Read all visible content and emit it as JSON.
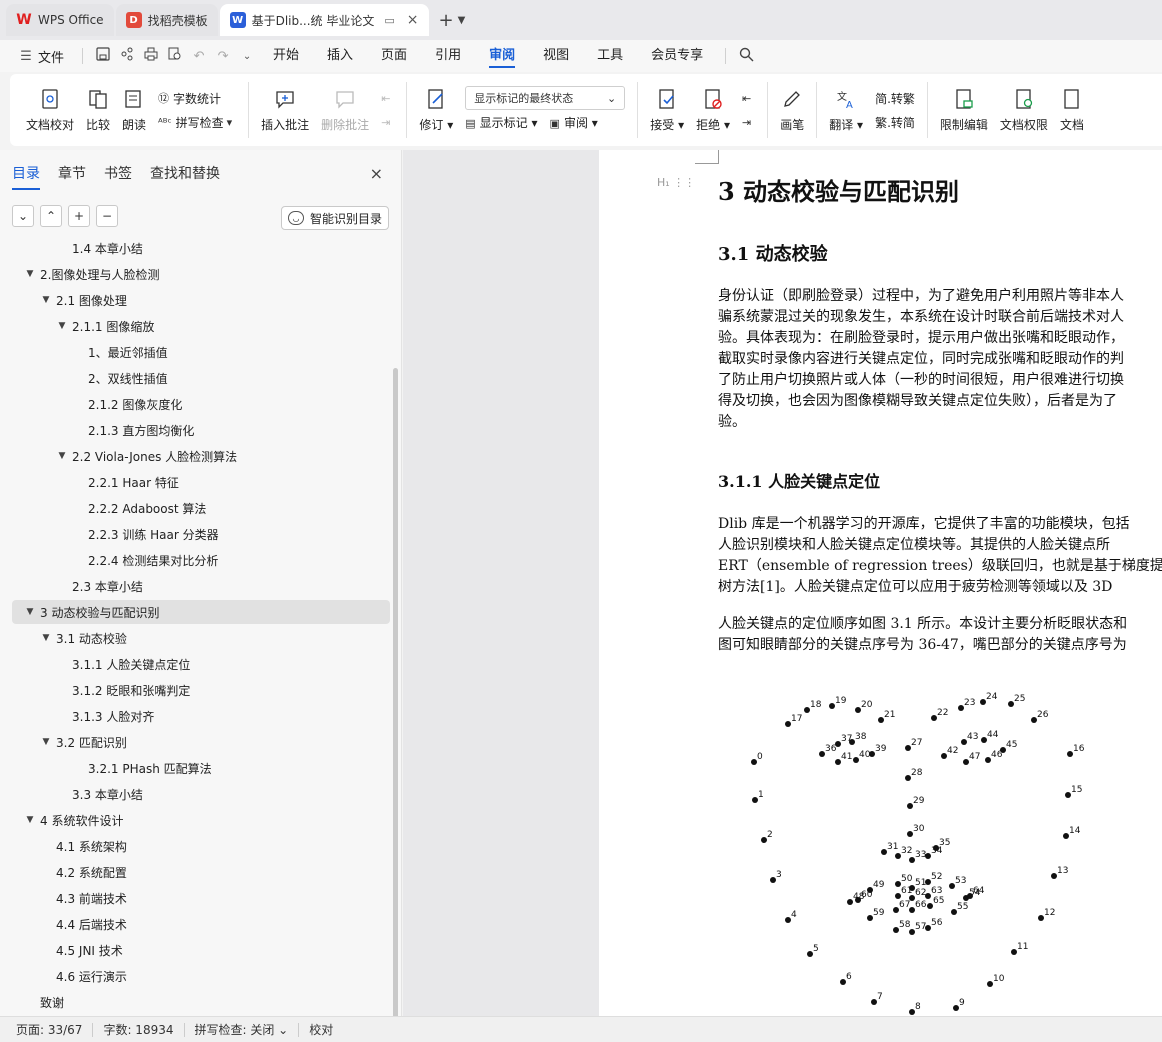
{
  "titlebar": {
    "tabs": [
      {
        "label": "WPS Office",
        "icon": "wps-logo-icon",
        "color": "#e02020"
      },
      {
        "label": "找稻壳模板",
        "icon": "docer-icon",
        "color": "#e24a3b"
      },
      {
        "label": "基于Dlib...统 毕业论文",
        "icon": "word-doc-icon",
        "color": "#2b5fd9"
      }
    ],
    "new_tab": "+",
    "close": "×"
  },
  "menubar": {
    "file_label": "文件",
    "tabs": [
      "开始",
      "插入",
      "页面",
      "引用",
      "审阅",
      "视图",
      "工具",
      "会员专享"
    ],
    "active_tab": "审阅"
  },
  "ribbon": {
    "proofread": "文档校对",
    "compare": "比较",
    "read_aloud": "朗读",
    "word_count": "字数统计",
    "spell_check": "拼写检查",
    "insert_comment": "插入批注",
    "delete_comment": "删除批注",
    "track_changes": "修订",
    "display_state": "显示标记的最终状态",
    "show_markup": "显示标记",
    "review": "审阅",
    "accept": "接受",
    "reject": "拒绝",
    "pen": "画笔",
    "translate": "翻译",
    "trad_to_simp": "简.转繁",
    "simp_to_trad": "繁.转简",
    "restrict_edit": "限制编辑",
    "doc_permission": "文档权限",
    "doc_more": "文档"
  },
  "leftpanel": {
    "tabs": [
      "目录",
      "章节",
      "书签",
      "查找和替换"
    ],
    "close": "×",
    "smart_toc": "智能识别目录",
    "toc": [
      {
        "text": "1.4 本章小结",
        "level": 2,
        "caret": ""
      },
      {
        "text": "2.图像处理与人脸检测",
        "level": 0,
        "caret": "▼"
      },
      {
        "text": "2.1 图像处理",
        "level": 1,
        "caret": "▼"
      },
      {
        "text": "2.1.1 图像缩放",
        "level": 2,
        "caret": "▼"
      },
      {
        "text": "1、最近邻插值",
        "level": 3,
        "caret": ""
      },
      {
        "text": "2、双线性插值",
        "level": 3,
        "caret": ""
      },
      {
        "text": "2.1.2 图像灰度化",
        "level": 3,
        "caret": ""
      },
      {
        "text": "2.1.3 直方图均衡化",
        "level": 3,
        "caret": ""
      },
      {
        "text": "2.2 Viola-Jones 人脸检测算法",
        "level": 2,
        "caret": "▼"
      },
      {
        "text": "2.2.1 Haar 特征",
        "level": 3,
        "caret": ""
      },
      {
        "text": "2.2.2 Adaboost 算法",
        "level": 3,
        "caret": ""
      },
      {
        "text": "2.2.3 训练 Haar 分类器",
        "level": 3,
        "caret": ""
      },
      {
        "text": "2.2.4 检测结果对比分析",
        "level": 3,
        "caret": ""
      },
      {
        "text": "2.3 本章小结",
        "level": 2,
        "caret": ""
      },
      {
        "text": "3 动态校验与匹配识别",
        "level": 0,
        "caret": "▼",
        "selected": true
      },
      {
        "text": "3.1 动态校验",
        "level": 1,
        "caret": "▼"
      },
      {
        "text": "3.1.1 人脸关键点定位",
        "level": 2,
        "caret": ""
      },
      {
        "text": "3.1.2 眨眼和张嘴判定",
        "level": 2,
        "caret": ""
      },
      {
        "text": "3.1.3 人脸对齐",
        "level": 2,
        "caret": ""
      },
      {
        "text": "3.2 匹配识别",
        "level": 1,
        "caret": "▼"
      },
      {
        "text": "3.2.1 PHash 匹配算法",
        "level": 3,
        "caret": ""
      },
      {
        "text": "3.3 本章小结",
        "level": 2,
        "caret": ""
      },
      {
        "text": "4 系统软件设计",
        "level": 0,
        "caret": "▼"
      },
      {
        "text": "4.1 系统架构",
        "level": 1,
        "caret": ""
      },
      {
        "text": "4.2 系统配置",
        "level": 1,
        "caret": ""
      },
      {
        "text": "4.3 前端技术",
        "level": 1,
        "caret": ""
      },
      {
        "text": "4.4 后端技术",
        "level": 1,
        "caret": ""
      },
      {
        "text": "4.5 JNI 技术",
        "level": 1,
        "caret": ""
      },
      {
        "text": "4.6 运行演示",
        "level": 1,
        "caret": ""
      },
      {
        "text": "致谢",
        "level": 0,
        "caret": ""
      }
    ]
  },
  "document": {
    "h1": "3 动态校验与匹配识别",
    "h2": "3.1  动态校验",
    "p1": [
      "身份认证（即刷脸登录）过程中，为了避免用户利用照片等非本人",
      "骗系统蒙混过关的现象发生，本系统在设计时联合前后端技术对人",
      "验。具体表现为：在刷脸登录时，提示用户做出张嘴和眨眼动作，",
      "截取实时录像内容进行关键点定位，同时完成张嘴和眨眼动作的判",
      "了防止用户切换照片或人体（一秒的时间很短，用户很难进行切换",
      "得及切换，也会因为图像模糊导致关键点定位失败），后者是为了",
      "验。"
    ],
    "h3": "3.1.1 人脸关键点定位",
    "p2": [
      "Dlib 库是一个机器学习的开源库，它提供了丰富的功能模块，包括",
      "人脸识别模块和人脸关键点定位模块等。其提供的人脸关键点所",
      "ERT（ensemble of regression trees）级联回归，也就是基于梯度提",
      "树方法[1]。人脸关键点定位可以应用于疲劳检测等领域以及 3D"
    ],
    "p3": [
      "人脸关键点的定位顺序如图 3.1 所示。本设计主要分析眨眼状态和",
      "图可知眼睛部分的关键点序号为 36-47，嘴巴部分的关键点序号为"
    ]
  },
  "statusbar": {
    "page": "页面: 33/67",
    "words": "字数: 18934",
    "spell": "拼写检查: 关闭",
    "proof": "校对"
  }
}
